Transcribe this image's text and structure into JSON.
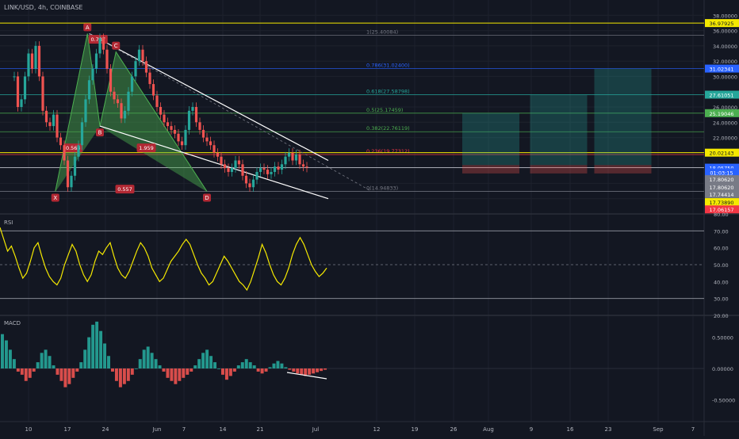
{
  "symbol_title": "LINK/USD, 4h, COINBASE",
  "theme": {
    "background": "#131722",
    "grid": "#1e222d",
    "separator": "#2a2e39",
    "axis_text": "#b2b5be",
    "up": "#26a69a",
    "down": "#ef5350",
    "rsi": "#f5e900",
    "fib_teal": "#26a69a",
    "fib_blue": "#2962ff",
    "fib_gray": "#787b86",
    "fib_lime": "#4caf50",
    "fib_red": "#f23645",
    "yellow": "#f5e900",
    "harmonic_fill": "#4caf50"
  },
  "chart_data": [
    {
      "name": "price",
      "type": "candlestick",
      "x_ticks": [
        "10",
        "17",
        "24",
        "Jun",
        "7",
        "14",
        "21",
        "Jul",
        "12",
        "19",
        "26",
        "Aug",
        "9",
        "16",
        "23",
        "Sep",
        "7"
      ],
      "y_ticks": [
        "38.00000",
        "36.00000",
        "34.00000",
        "32.00000",
        "30.00000",
        "26.00000",
        "24.00000",
        "22.00000"
      ],
      "price_path_points": [
        [
          0,
          30
        ],
        [
          1,
          26
        ],
        [
          2,
          27
        ],
        [
          3,
          30
        ],
        [
          4,
          33
        ],
        [
          5,
          31
        ],
        [
          6,
          34
        ],
        [
          7,
          30
        ],
        [
          8,
          25.5
        ],
        [
          9,
          24
        ],
        [
          10,
          23.5
        ],
        [
          11,
          25
        ],
        [
          12,
          22
        ],
        [
          13,
          21
        ],
        [
          14,
          19
        ],
        [
          15,
          15.5
        ],
        [
          16,
          17
        ],
        [
          17,
          19.5
        ],
        [
          18,
          21
        ],
        [
          19,
          24
        ],
        [
          20,
          27
        ],
        [
          21,
          29.5
        ],
        [
          22,
          31
        ],
        [
          23,
          33
        ],
        [
          24,
          35
        ],
        [
          25,
          33.5
        ],
        [
          26,
          31
        ],
        [
          27,
          28
        ],
        [
          28,
          27
        ],
        [
          29,
          26.5
        ],
        [
          30,
          24.5
        ],
        [
          31,
          25.5
        ],
        [
          32,
          28
        ],
        [
          33,
          30
        ],
        [
          34,
          32
        ],
        [
          35,
          33.5
        ],
        [
          36,
          32
        ],
        [
          37,
          30.5
        ],
        [
          38,
          29
        ],
        [
          39,
          27.5
        ],
        [
          40,
          26
        ],
        [
          41,
          25
        ],
        [
          42,
          24
        ],
        [
          43,
          23.5
        ],
        [
          44,
          23
        ],
        [
          45,
          22.5
        ],
        [
          46,
          21.5
        ],
        [
          47,
          21
        ],
        [
          48,
          23
        ],
        [
          49,
          25.5
        ],
        [
          50,
          26
        ],
        [
          51,
          24
        ],
        [
          52,
          23
        ],
        [
          53,
          22
        ],
        [
          54,
          21.5
        ],
        [
          55,
          21
        ],
        [
          56,
          20
        ],
        [
          57,
          19.5
        ],
        [
          58,
          18.5
        ],
        [
          59,
          18
        ],
        [
          60,
          17.5
        ],
        [
          61,
          18
        ],
        [
          62,
          19
        ],
        [
          63,
          18.5
        ],
        [
          64,
          17
        ],
        [
          65,
          16
        ],
        [
          66,
          15.5
        ],
        [
          67,
          16.5
        ],
        [
          68,
          17.5
        ],
        [
          69,
          18
        ],
        [
          70,
          17.8
        ],
        [
          71,
          17.2
        ],
        [
          72,
          17.5
        ],
        [
          73,
          18.2
        ],
        [
          74,
          17.8
        ],
        [
          75,
          18.5
        ],
        [
          76,
          19.5
        ],
        [
          77,
          20
        ],
        [
          78,
          19
        ],
        [
          79,
          19.8
        ],
        [
          80,
          18.5
        ],
        [
          81,
          18.2
        ],
        [
          82,
          18.06
        ]
      ],
      "price_labels": [
        {
          "label": "36.97925",
          "color": "#f5e900",
          "text_color": "#131722",
          "value": 36.97925
        },
        {
          "label": "31.02341",
          "color": "#2962ff",
          "text_color": "#ffffff",
          "value": 31.02341
        },
        {
          "label": "27.61051",
          "color": "#26a69a",
          "text_color": "#ffffff",
          "value": 27.61051
        },
        {
          "label": "25.19046",
          "color": "#4caf50",
          "text_color": "#ffffff",
          "value": 25.19046
        },
        {
          "label": "20.02143",
          "color": "#f5e900",
          "text_color": "#131722",
          "value": 20.02143
        },
        {
          "label": "18.05750",
          "color": "#2962ff",
          "text_color": "#ffffff",
          "value": 18.0575
        },
        {
          "label": "01:03:15",
          "color": "#2962ff",
          "text_color": "#ffffff",
          "value": 17.45
        },
        {
          "label": "17.80620",
          "color": "#787b86",
          "text_color": "#ffffff",
          "value": 16.55
        },
        {
          "label": "17.80620",
          "color": "#787b86",
          "text_color": "#ffffff",
          "value": 15.55
        },
        {
          "label": "17.74414",
          "color": "#787b86",
          "text_color": "#ffffff",
          "value": 14.6
        },
        {
          "label": "17.73890",
          "color": "#f5e900",
          "text_color": "#131722",
          "value": 13.55
        },
        {
          "label": "17.06157",
          "color": "#f23645",
          "text_color": "#ffffff",
          "value": 12.6
        }
      ],
      "fib_levels": [
        {
          "label": "1(25.40084)",
          "value": 35.4,
          "color": "#787b86"
        },
        {
          "label": "0.786(31.02400)",
          "value": 31.02,
          "color": "#2962ff"
        },
        {
          "label": "0.618(27.58798)",
          "value": 27.6,
          "color": "#26a69a"
        },
        {
          "label": "0.5(25.17459)",
          "value": 25.19,
          "color": "#4caf50"
        },
        {
          "label": "0.382(22.76119)",
          "value": 22.76,
          "color": "#4caf50"
        },
        {
          "label": "0.236(19.77312)",
          "value": 19.77,
          "color": "#f23645"
        },
        {
          "label": "0(14.94833)",
          "value": 14.95,
          "color": "#787b86"
        }
      ],
      "harmonic_points": [
        {
          "label": "X",
          "x": 11.5,
          "y": 14.95
        },
        {
          "label": "A",
          "x": 20.5,
          "y": 35.6
        },
        {
          "label": "B",
          "x": 24,
          "y": 23.5
        },
        {
          "label": "C",
          "x": 28.5,
          "y": 33.2
        },
        {
          "label": "D",
          "x": 54,
          "y": 14.95
        }
      ],
      "harmonic_ratios": [
        {
          "label": "0.787",
          "x": 23.5,
          "y": 34.8
        },
        {
          "label": "0.568",
          "x": 16.5,
          "y": 20.6
        },
        {
          "label": "1.959",
          "x": 37,
          "y": 20.6
        },
        {
          "label": "0.557",
          "x": 31,
          "y": 15.2
        }
      ],
      "target_boxes": [
        {
          "x_start": 82,
          "x_end": 98,
          "y_top": 25.2
        },
        {
          "x_start": 101,
          "x_end": 117,
          "y_top": 27.6
        },
        {
          "x_start": 119,
          "x_end": 135,
          "y_top": 31
        }
      ]
    },
    {
      "name": "RSI",
      "type": "line",
      "label": "RSI",
      "y_ticks": [
        "80.00",
        "70.00",
        "60.00",
        "50.00",
        "40.00",
        "30.00",
        "20.00"
      ],
      "levels": [
        70,
        50,
        30
      ],
      "values": [
        72,
        65,
        58,
        61,
        55,
        48,
        42,
        45,
        52,
        60,
        63,
        55,
        48,
        43,
        40,
        38,
        42,
        50,
        56,
        62,
        58,
        50,
        44,
        40,
        44,
        52,
        58,
        56,
        60,
        63,
        55,
        48,
        44,
        42,
        46,
        52,
        58,
        63,
        60,
        55,
        48,
        44,
        40,
        42,
        47,
        52,
        55,
        58,
        62,
        65,
        62,
        56,
        50,
        45,
        42,
        38,
        40,
        45,
        50,
        55,
        52,
        48,
        44,
        40,
        38,
        35,
        40,
        47,
        54,
        62,
        57,
        50,
        44,
        40,
        38,
        42,
        48,
        56,
        62,
        66,
        62,
        56,
        50,
        46,
        43,
        45,
        48
      ]
    },
    {
      "name": "MACD",
      "type": "bar",
      "label": "MACD",
      "y_ticks": [
        "0.50000",
        "0.00000",
        "-0.50000"
      ],
      "values": [
        0.55,
        0.45,
        0.3,
        0.15,
        -0.05,
        -0.1,
        -0.2,
        -0.15,
        -0.05,
        0.1,
        0.25,
        0.3,
        0.2,
        0.05,
        -0.1,
        -0.2,
        -0.3,
        -0.25,
        -0.15,
        -0.05,
        0.1,
        0.3,
        0.5,
        0.7,
        0.75,
        0.6,
        0.4,
        0.2,
        -0.05,
        -0.2,
        -0.3,
        -0.25,
        -0.2,
        -0.1,
        0.0,
        0.15,
        0.3,
        0.35,
        0.25,
        0.15,
        0.05,
        -0.05,
        -0.15,
        -0.2,
        -0.25,
        -0.2,
        -0.15,
        -0.1,
        -0.05,
        0.05,
        0.15,
        0.25,
        0.3,
        0.2,
        0.1,
        0.0,
        -0.1,
        -0.18,
        -0.12,
        -0.05,
        0.05,
        0.1,
        0.15,
        0.1,
        0.05,
        -0.05,
        -0.08,
        -0.05,
        0.02,
        0.08,
        0.12,
        0.08,
        0.02,
        -0.02,
        -0.05,
        -0.08,
        -0.1,
        -0.12,
        -0.1,
        -0.08,
        -0.06,
        -0.04,
        -0.02
      ]
    }
  ]
}
